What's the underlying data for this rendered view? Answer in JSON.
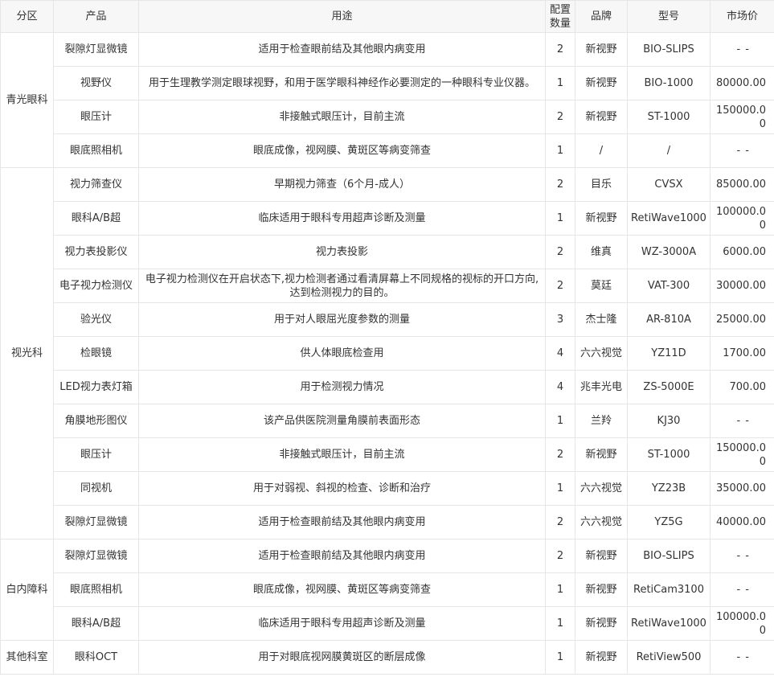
{
  "headers": {
    "zone": "分区",
    "product": "产品",
    "usage": "用途",
    "qty": "配置数量",
    "brand": "品牌",
    "model": "型号",
    "price": "市场价"
  },
  "groups": [
    {
      "zone": "青光眼科",
      "rows": [
        {
          "product": "裂隙灯显微镜",
          "usage": "适用于检查眼前结及其他眼内病变用",
          "qty": "2",
          "brand": "新视野",
          "model": "BIO-SLIPS",
          "price": "- -"
        },
        {
          "product": "视野仪",
          "usage": "用于生理教学测定眼球视野，和用于医学眼科神经作必要测定的一种眼科专业仪器。",
          "qty": "1",
          "brand": "新视野",
          "model": "BIO-1000",
          "price": "80000.00"
        },
        {
          "product": "眼压计",
          "usage": "非接触式眼压计，目前主流",
          "qty": "2",
          "brand": "新视野",
          "model": "ST-1000",
          "price": "150000.00"
        },
        {
          "product": "眼底照相机",
          "usage": "眼底成像，视网膜、黄斑区等病变筛查",
          "qty": "1",
          "brand": "/",
          "model": "/",
          "price": "- -"
        }
      ]
    },
    {
      "zone": "视光科",
      "rows": [
        {
          "product": "视力筛查仪",
          "usage": "早期视力筛查（6个月-成人）",
          "qty": "2",
          "brand": "目乐",
          "model": "CVSX",
          "price": "85000.00"
        },
        {
          "product": "眼科A/B超",
          "usage": "临床适用于眼科专用超声诊断及测量",
          "qty": "1",
          "brand": "新视野",
          "model": "RetiWave1000",
          "price": "100000.00"
        },
        {
          "product": "视力表投影仪",
          "usage": "视力表投影",
          "qty": "2",
          "brand": "维真",
          "model": "WZ-3000A",
          "price": "6000.00"
        },
        {
          "product": "电子视力检测仪",
          "usage": "电子视力检测仪在开启状态下,视力检测者通过看清屏幕上不同规格的视标的开口方向,达到检测视力的目的。",
          "qty": "2",
          "brand": "莫廷",
          "model": "VAT-300",
          "price": "30000.00"
        },
        {
          "product": "验光仪",
          "usage": "用于对人眼屈光度参数的测量",
          "qty": "3",
          "brand": "杰士隆",
          "model": "AR-810A",
          "price": "25000.00"
        },
        {
          "product": "检眼镜",
          "usage": "供人体眼底检查用",
          "qty": "4",
          "brand": "六六视觉",
          "model": "YZ11D",
          "price": "1700.00"
        },
        {
          "product": "LED视力表灯箱",
          "usage": "用于检测视力情况",
          "qty": "4",
          "brand": "兆丰光电",
          "model": "ZS-5000E",
          "price": "700.00"
        },
        {
          "product": "角膜地形图仪",
          "usage": "该产品供医院测量角膜前表面形态",
          "qty": "1",
          "brand": "兰羚",
          "model": "KJ30",
          "price": "- -"
        },
        {
          "product": "眼压计",
          "usage": "非接触式眼压计，目前主流",
          "qty": "2",
          "brand": "新视野",
          "model": "ST-1000",
          "price": "150000.00"
        },
        {
          "product": "同视机",
          "usage": "用于对弱视、斜视的检查、诊断和治疗",
          "qty": "1",
          "brand": "六六视觉",
          "model": "YZ23B",
          "price": "35000.00"
        },
        {
          "product": "裂隙灯显微镜",
          "usage": "适用于检查眼前结及其他眼内病变用",
          "qty": "2",
          "brand": "六六视觉",
          "model": "YZ5G",
          "price": "40000.00"
        }
      ]
    },
    {
      "zone": "白内障科",
      "rows": [
        {
          "product": "裂隙灯显微镜",
          "usage": "适用于检查眼前结及其他眼内病变用",
          "qty": "2",
          "brand": "新视野",
          "model": "BIO-SLIPS",
          "price": "- -"
        },
        {
          "product": "眼底照相机",
          "usage": "眼底成像，视网膜、黄斑区等病变筛查",
          "qty": "1",
          "brand": "新视野",
          "model": "RetiCam3100",
          "price": "- -"
        },
        {
          "product": "眼科A/B超",
          "usage": "临床适用于眼科专用超声诊断及测量",
          "qty": "1",
          "brand": "新视野",
          "model": "RetiWave1000",
          "price": "100000.00"
        }
      ]
    },
    {
      "zone": "其他科室",
      "rows": [
        {
          "product": "眼科OCT",
          "usage": "用于对眼底视网膜黄斑区的断层成像",
          "qty": "1",
          "brand": "新视野",
          "model": "RetiView500",
          "price": "- -"
        }
      ]
    }
  ]
}
